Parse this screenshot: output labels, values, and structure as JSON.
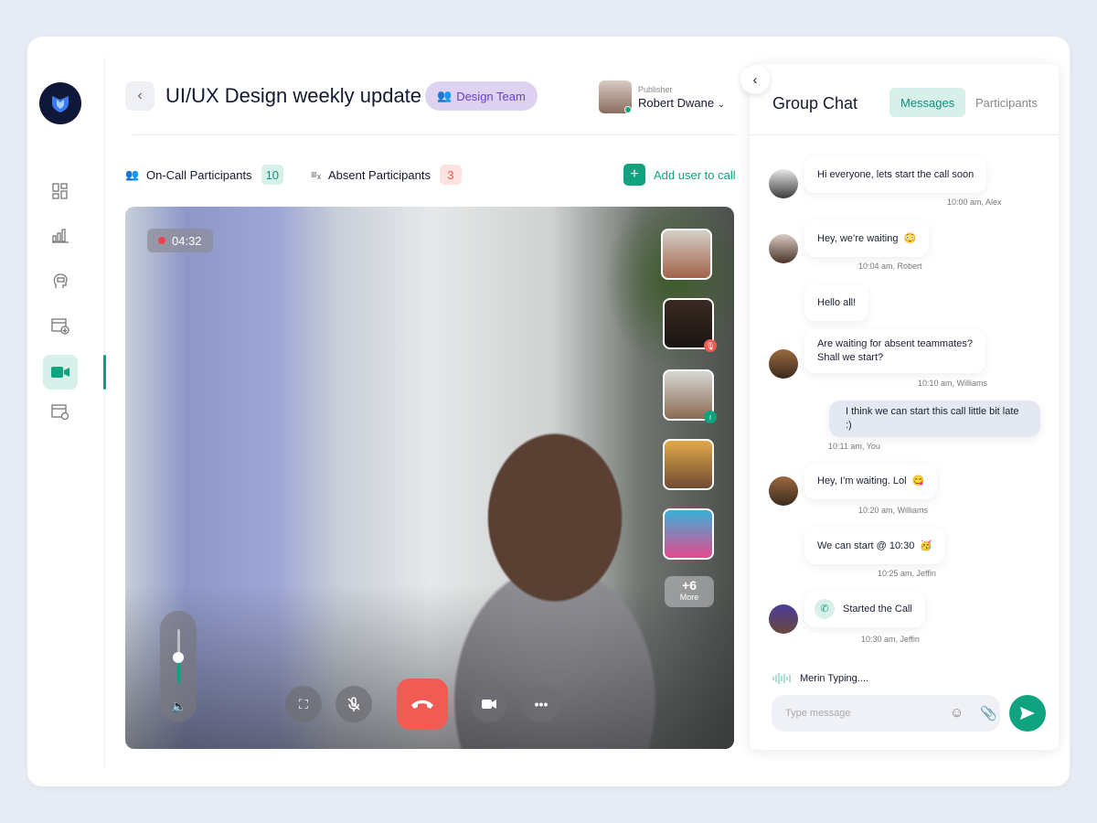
{
  "colors": {
    "accent": "#10a37f",
    "danger": "#f05b54",
    "team_badge": "#ddd3f1"
  },
  "header": {
    "title": "UI/UX Design weekly update",
    "team": "Design Team",
    "publisher_label": "Publisher",
    "publisher_name": "Robert Dwane"
  },
  "sidebar": {
    "items": [
      {
        "icon": "dashboard-icon"
      },
      {
        "icon": "chart-icon"
      },
      {
        "icon": "chat-head-icon"
      },
      {
        "icon": "download-window-icon"
      },
      {
        "icon": "video-icon",
        "active": true
      },
      {
        "icon": "settings-window-icon"
      }
    ]
  },
  "stats": {
    "on_call_label": "On-Call Participants",
    "on_call_count": "10",
    "absent_label": "Absent Participants",
    "absent_count": "3",
    "add_label": "Add user to call"
  },
  "video": {
    "timer": "04:32",
    "more_count": "+6",
    "more_label": "More",
    "volume_percent": 50
  },
  "chat": {
    "title": "Group Chat",
    "tabs": [
      "Messages",
      "Participants"
    ],
    "messages": [
      {
        "text": "Hi everyone, lets start the call soon",
        "meta": "10:00 am, Alex"
      },
      {
        "text": "Hey, we’re waiting",
        "emoji": "😳",
        "meta": "10:04 am, Robert"
      },
      {
        "text": "Hello all!"
      },
      {
        "text": "Are waiting for absent teammates?",
        "text2": "Shall we start?",
        "meta": "10:10 am, Williams"
      },
      {
        "text": "I think we can start this call little bit late :)",
        "meta": "10:11 am, You"
      },
      {
        "text": "Hey, I’m waiting. Lol",
        "emoji": "😋",
        "meta": "10:20 am, Williams"
      },
      {
        "text": "We can start @ 10:30",
        "emoji": "🥳",
        "meta": "10:25 am, Jeffin"
      },
      {
        "text": "Started the Call",
        "meta": "10:30 am, Jeffin"
      }
    ],
    "typing": "Merin Typing....",
    "placeholder": "Type message"
  }
}
